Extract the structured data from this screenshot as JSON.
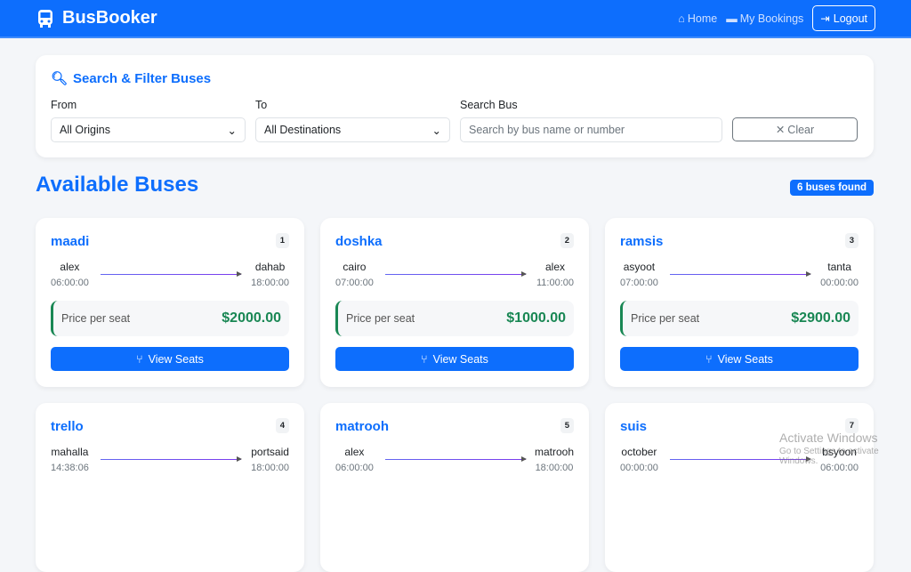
{
  "nav": {
    "brand": "BusBooker",
    "home": "Home",
    "bookings": "My Bookings",
    "logout": "Logout"
  },
  "filter": {
    "title": "Search & Filter Buses",
    "from_label": "From",
    "from_value": "All Origins",
    "to_label": "To",
    "to_value": "All Destinations",
    "search_label": "Search Bus",
    "search_placeholder": "Search by bus name or number",
    "clear": "Clear"
  },
  "main": {
    "heading": "Available Buses",
    "count": "6 buses found",
    "price_label": "Price per seat",
    "view_seats": "View Seats"
  },
  "buses": [
    {
      "name": "maadi",
      "id": "1",
      "from": "alex",
      "dep": "06:00:00",
      "to": "dahab",
      "arr": "18:00:00",
      "price": "$2000.00"
    },
    {
      "name": "doshka",
      "id": "2",
      "from": "cairo",
      "dep": "07:00:00",
      "to": "alex",
      "arr": "11:00:00",
      "price": "$1000.00"
    },
    {
      "name": "ramsis",
      "id": "3",
      "from": "asyoot",
      "dep": "07:00:00",
      "to": "tanta",
      "arr": "00:00:00",
      "price": "$2900.00"
    },
    {
      "name": "trello",
      "id": "4",
      "from": "mahalla",
      "dep": "14:38:06",
      "to": "portsaid",
      "arr": "18:00:00"
    },
    {
      "name": "matrooh",
      "id": "5",
      "from": "alex",
      "dep": "06:00:00",
      "to": "matrooh",
      "arr": "18:00:00"
    },
    {
      "name": "suis",
      "id": "7",
      "from": "october",
      "dep": "00:00:00",
      "to": "bsyoon",
      "arr": "06:00:00"
    }
  ],
  "watermark": {
    "line1": "Activate Windows",
    "line2": "Go to Settings to activate Windows."
  }
}
